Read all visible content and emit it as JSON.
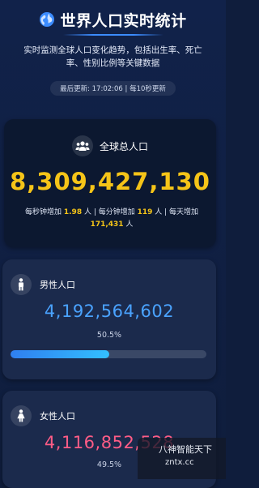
{
  "header": {
    "title": "世界人口实时统计",
    "subtitle": "实时监测全球人口变化趋势，包括出生率、死亡率、性别比例等关键数据",
    "last_update": "最后更新: 17:02:06 | 每10秒更新"
  },
  "total": {
    "label": "全球总人口",
    "value": "8,309,427,130",
    "rate_prefix": "每秒钟增加 ",
    "per_second": "1.98",
    "rate_mid1": " 人 | 每分钟增加 ",
    "per_minute": "119",
    "rate_mid2": " 人 | 每天增加 ",
    "per_day": "171,431",
    "rate_suffix": " 人",
    "icon": "people-group-icon",
    "accent": "#f5c418"
  },
  "male": {
    "label": "男性人口",
    "value": "4,192,564,602",
    "percent_text": "50.5%",
    "share": 0.505,
    "icon": "male-person-icon",
    "accent": "#4aa3ff"
  },
  "female": {
    "label": "女性人口",
    "value": "4,116,852,528",
    "percent_text": "49.5%",
    "share": 0.495,
    "icon": "female-person-icon",
    "accent": "#ff5c86"
  },
  "watermark": {
    "line1": "八神智能天下",
    "line2": "zntx.cc"
  }
}
